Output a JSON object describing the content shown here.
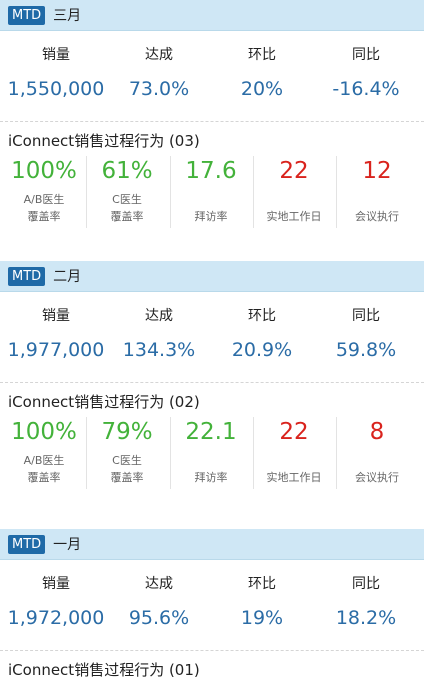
{
  "sections": [
    {
      "badge": "MTD",
      "month": "三月",
      "kpis": [
        {
          "label": "销量",
          "value": "1,550,000"
        },
        {
          "label": "达成",
          "value": "73.0%"
        },
        {
          "label": "环比",
          "value": "20%"
        },
        {
          "label": "同比",
          "value": "-16.4%"
        }
      ],
      "behavior_title": "iConnect销售过程行为 (03)",
      "metrics": [
        {
          "value": "100%",
          "label1": "A/B医生",
          "label2": "覆盖率",
          "color": "#43b23a"
        },
        {
          "value": "61%",
          "label1": "C医生",
          "label2": "覆盖率",
          "color": "#43b23a"
        },
        {
          "value": "17.6",
          "label1": "",
          "label2": "拜访率",
          "color": "#43b23a"
        },
        {
          "value": "22",
          "label1": "",
          "label2": "实地工作日",
          "color": "#d9231d"
        },
        {
          "value": "12",
          "label1": "",
          "label2": "会议执行",
          "color": "#d9231d"
        }
      ]
    },
    {
      "badge": "MTD",
      "month": "二月",
      "kpis": [
        {
          "label": "销量",
          "value": "1,977,000"
        },
        {
          "label": "达成",
          "value": "134.3%"
        },
        {
          "label": "环比",
          "value": "20.9%"
        },
        {
          "label": "同比",
          "value": "59.8%"
        }
      ],
      "behavior_title": "iConnect销售过程行为 (02)",
      "metrics": [
        {
          "value": "100%",
          "label1": "A/B医生",
          "label2": "覆盖率",
          "color": "#43b23a"
        },
        {
          "value": "79%",
          "label1": "C医生",
          "label2": "覆盖率",
          "color": "#43b23a"
        },
        {
          "value": "22.1",
          "label1": "",
          "label2": "拜访率",
          "color": "#43b23a"
        },
        {
          "value": "22",
          "label1": "",
          "label2": "实地工作日",
          "color": "#d9231d"
        },
        {
          "value": "8",
          "label1": "",
          "label2": "会议执行",
          "color": "#d9231d"
        }
      ]
    },
    {
      "badge": "MTD",
      "month": "一月",
      "kpis": [
        {
          "label": "销量",
          "value": "1,972,000"
        },
        {
          "label": "达成",
          "value": "95.6%"
        },
        {
          "label": "环比",
          "value": "19%"
        },
        {
          "label": "同比",
          "value": "18.2%"
        }
      ],
      "behavior_title": "iConnect销售过程行为 (01)"
    }
  ]
}
